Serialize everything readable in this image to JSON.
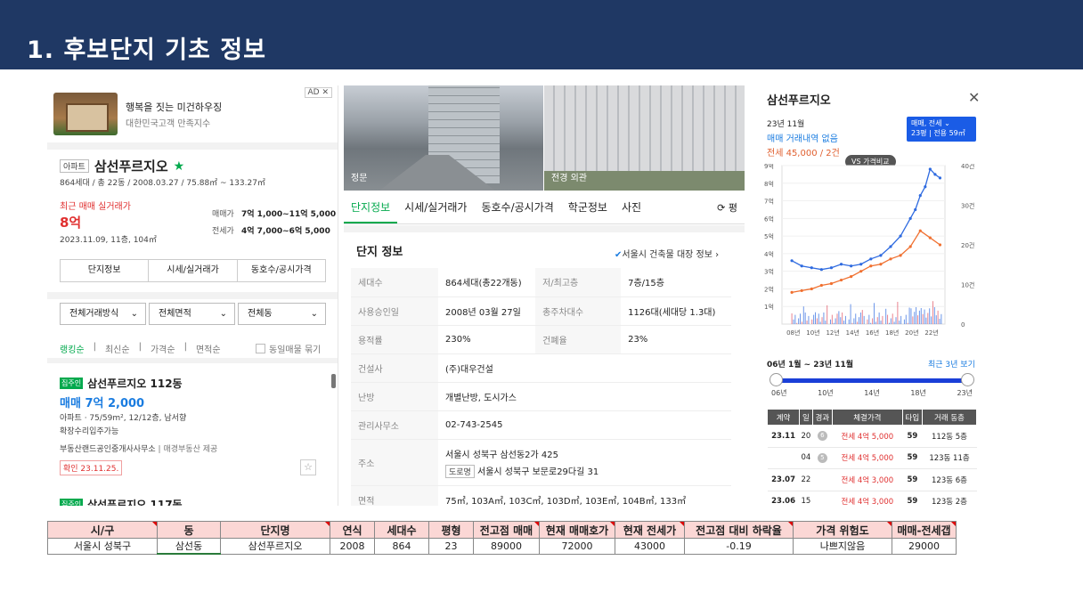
{
  "slide": {
    "title": "1. 후보단지 기초 정보"
  },
  "left": {
    "ad": {
      "badge": "AD ✕",
      "title": "행복을 짓는 미건하우징",
      "subtitle": "대한민국고객 만족지수"
    },
    "type_tag": "아파트",
    "name": "삼선푸르지오",
    "star": "★",
    "meta": "864세대 / 총 22동 / 2008.03.27 / 75.88㎡ ~ 133.27㎡",
    "recent_label": "최근 매매 실거래가",
    "recent_price": "8억",
    "recent_date": "2023.11.09, 11층, 104㎡",
    "sale_label": "매매가",
    "sale_value": "7억 1,000~11억 5,000",
    "jeonse_label": "전세가",
    "jeonse_value": "4억 7,000~6억 5,000",
    "buttons": [
      "단지정보",
      "시세/실거래가",
      "동호수/공시가격"
    ],
    "selects": [
      "전체거래방식",
      "전체면적",
      "전체동"
    ],
    "sort": [
      "랭킹순",
      "최신순",
      "가격순",
      "면적순"
    ],
    "same_listing": "동일매물 묶기",
    "listing": {
      "chip": "집주인",
      "title": "삼선푸르지오 112동",
      "price": "매매 7억 2,000",
      "detail": "아파트 · 75/59m², 12/12층, 남서향",
      "note": "확장수리입주가능",
      "agent": "부동산랜드공인중개사사무소",
      "provider": "매경부동산 제공",
      "confirm": "확인 23.11.25."
    },
    "next_listing": {
      "chip": "집주인",
      "title": "삼선푸르지오 117동"
    }
  },
  "middle": {
    "photo_caps": [
      "정문",
      "전경 외관"
    ],
    "tabs": [
      "단지정보",
      "시세/실거래가",
      "동호수/공시가격",
      "학군정보",
      "사진"
    ],
    "tab_extra": "⟳ 평",
    "section_title": "단지 정보",
    "section_link": "서울시 건축물 대장 정보",
    "rows": [
      {
        "k1": "세대수",
        "v1": "864세대(총22개동)",
        "k2": "저/최고층",
        "v2": "7층/15층"
      },
      {
        "k1": "사용승인일",
        "v1": "2008년 03월 27일",
        "k2": "총주차대수",
        "v2": "1126대(세대당 1.3대)"
      },
      {
        "k1": "용적률",
        "v1": "230%",
        "k2": "건폐율",
        "v2": "23%"
      },
      {
        "k1": "건설사",
        "v1": "(주)대우건설",
        "k2": "",
        "v2": ""
      },
      {
        "k1": "난방",
        "v1": "개별난방, 도시가스",
        "k2": "",
        "v2": ""
      },
      {
        "k1": "관리사무소",
        "v1": "02-743-2545",
        "k2": "",
        "v2": ""
      }
    ],
    "address_label": "주소",
    "address_1": "서울시 성북구 삼선동2가 425",
    "road_tag": "도로명",
    "address_2": "서울시 성북구 보문로29다길 31",
    "area_label": "면적",
    "area_value": "75㎡, 103A㎡, 103C㎡, 103D㎡, 103E㎡, 104B㎡, 133㎡"
  },
  "right": {
    "title": "삼선푸르지오",
    "month": "23년 11월",
    "no_sale": "매매 거래내역 없음",
    "jeonse": "전세 45,000 / 2건",
    "box_top": "매매, 전세 ⌄",
    "box_bottom": "23평 | 전용 59㎡",
    "vs_label": "VS 가격비교",
    "range": "06년 1월 ~ 23년 11월",
    "recent3": "최근 3년 보기",
    "slider_ticks": [
      "06년",
      "10년",
      "14년",
      "18년",
      "23년"
    ],
    "headers": [
      "계약",
      "일",
      "경과",
      "체결가격",
      "타입",
      "거래 동층"
    ],
    "deals": [
      {
        "m": "23.11",
        "d": "20",
        "e": "6",
        "p": "전세 4억 5,000",
        "t": "59",
        "f": "112동 5층"
      },
      {
        "m": "",
        "d": "04",
        "e": "5",
        "p": "전세 4억 5,000",
        "t": "59",
        "f": "123동 11층"
      },
      {
        "m": "23.07",
        "d": "22",
        "e": "",
        "p": "전세 4억 3,000",
        "t": "59",
        "f": "123동 6층"
      },
      {
        "m": "23.06",
        "d": "15",
        "e": "",
        "p": "전세 4억 3,000",
        "t": "59",
        "f": "123동 2층"
      }
    ]
  },
  "chart_data": {
    "type": "line",
    "x": [
      "08년",
      "10년",
      "12년",
      "14년",
      "16년",
      "18년",
      "20년",
      "22년"
    ],
    "y_left_ticks": [
      "9억",
      "8억",
      "7억",
      "6억",
      "5억",
      "4억",
      "3억",
      "2억",
      "1억"
    ],
    "y_right_ticks": [
      "40건",
      "30건",
      "20건",
      "10건",
      "0"
    ],
    "ylim_left": [
      0,
      9
    ],
    "ylim_right": [
      0,
      40
    ],
    "series": [
      {
        "name": "매매",
        "color": "#2f6be0",
        "x": [
          2008,
          2009,
          2010,
          2011,
          2012,
          2013,
          2014,
          2015,
          2016,
          2017,
          2018,
          2019,
          2020,
          2020.5,
          2021,
          2021.5,
          2022,
          2022.5,
          2023
        ],
        "values": [
          3.6,
          3.3,
          3.2,
          3.1,
          3.2,
          3.4,
          3.3,
          3.4,
          3.7,
          3.9,
          4.4,
          5.0,
          6.0,
          6.5,
          7.3,
          7.8,
          8.8,
          8.5,
          8.3
        ]
      },
      {
        "name": "전세",
        "color": "#f07030",
        "x": [
          2008,
          2009,
          2010,
          2011,
          2012,
          2013,
          2014,
          2015,
          2016,
          2017,
          2018,
          2019,
          2020,
          2021,
          2022,
          2023
        ],
        "values": [
          1.8,
          1.9,
          2.0,
          2.2,
          2.3,
          2.5,
          2.7,
          3.0,
          3.3,
          3.4,
          3.7,
          3.9,
          4.4,
          5.3,
          4.9,
          4.5
        ]
      }
    ],
    "volume_colors": [
      "#2f6be0",
      "#e05060"
    ]
  },
  "summary": {
    "headers": [
      "시/구",
      "동",
      "단지명",
      "연식",
      "세대수",
      "평형",
      "전고점 매매",
      "현재 매매호가",
      "현재 전세가",
      "전고점 대비 하락율",
      "가격 위험도",
      "매매-전세갭"
    ],
    "row": [
      "서울시 성북구",
      "삼선동",
      "삼선푸르지오",
      "2008",
      "864",
      "23",
      "89000",
      "72000",
      "43000",
      "-0.19",
      "나쁘지않음",
      "29000"
    ]
  }
}
